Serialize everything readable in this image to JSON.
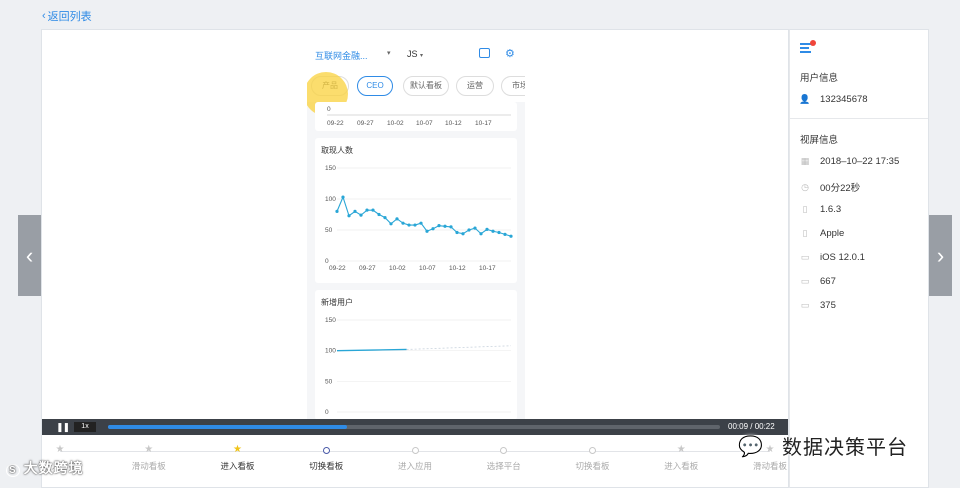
{
  "back_link": {
    "icon": "chevron-left-icon",
    "label": "返回列表"
  },
  "phone": {
    "app_name": "互联网金融...",
    "user": "JS",
    "tabs": [
      "产品",
      "CEO",
      "默认看板",
      "运营",
      "市场"
    ],
    "active_tab": "CEO",
    "top_axis_labels": [
      "09-22",
      "09-27",
      "10-02",
      "10-07",
      "10-12",
      "10-17"
    ],
    "top_axis_zero": "0",
    "cards": [
      {
        "title": "取现人数"
      },
      {
        "title": "新增用户"
      }
    ]
  },
  "chart_data": [
    {
      "type": "line",
      "title": "取现人数",
      "x": [
        "09-22",
        "09-23",
        "09-24",
        "09-25",
        "09-26",
        "09-27",
        "09-28",
        "09-29",
        "09-30",
        "10-01",
        "10-02",
        "10-03",
        "10-04",
        "10-05",
        "10-06",
        "10-07",
        "10-08",
        "10-09",
        "10-10",
        "10-11",
        "10-12",
        "10-13",
        "10-14",
        "10-15",
        "10-16",
        "10-17",
        "10-18",
        "10-19",
        "10-20",
        "10-21"
      ],
      "values": [
        80,
        103,
        73,
        80,
        74,
        82,
        82,
        75,
        70,
        60,
        68,
        61,
        58,
        58,
        61,
        48,
        52,
        57,
        56,
        55,
        46,
        44,
        50,
        53,
        44,
        51,
        48,
        46,
        43,
        40
      ],
      "tick_labels": [
        "09-22",
        "09-27",
        "10-02",
        "10-07",
        "10-12",
        "10-17"
      ],
      "y_ticks": [
        "0",
        "50",
        "100",
        "150"
      ],
      "ylim": [
        0,
        150
      ],
      "color": "#29a6d6"
    },
    {
      "type": "line",
      "title": "新增用户",
      "x": [
        "09-22",
        "09-27",
        "10-02",
        "10-07",
        "10-12",
        "10-17"
      ],
      "values": [
        100,
        101,
        102,
        104,
        106,
        108
      ],
      "y_ticks": [
        "0",
        "50",
        "100",
        "150"
      ],
      "ylim": [
        0,
        150
      ],
      "color": "#29a6d6"
    }
  ],
  "player": {
    "speed": "1x",
    "time": "00:09 / 00:22",
    "progress_fraction": 0.39
  },
  "timeline": [
    {
      "label": "进入看板",
      "marker": "star",
      "active": false
    },
    {
      "label": "滑动看板",
      "marker": "star",
      "active": false
    },
    {
      "label": "进入看板",
      "marker": "star",
      "active": true
    },
    {
      "label": "切换看板",
      "marker": "circle",
      "active": true
    },
    {
      "label": "进入应用",
      "marker": "circle",
      "active": false
    },
    {
      "label": "选择平台",
      "marker": "circle",
      "active": false
    },
    {
      "label": "切换看板",
      "marker": "circle",
      "active": false
    },
    {
      "label": "进入看板",
      "marker": "star",
      "active": false
    },
    {
      "label": "滑动看板",
      "marker": "star",
      "active": false
    }
  ],
  "sidebar": {
    "user_section": "用户信息",
    "user_id": "132345678",
    "screen_section": "视屏信息",
    "rows": [
      {
        "icon": "calendar-icon",
        "value": "2018–10–22 17:35"
      },
      {
        "icon": "clock-icon",
        "value": "00分22秒"
      },
      {
        "icon": "phone-icon",
        "value": "1.6.3"
      },
      {
        "icon": "phone-icon",
        "value": "Apple"
      },
      {
        "icon": "monitor-icon",
        "value": "iOS 12.0.1"
      },
      {
        "icon": "monitor-icon",
        "value": "667"
      },
      {
        "icon": "monitor-icon",
        "value": "375"
      }
    ]
  },
  "watermarks": {
    "left": "大数跨境",
    "right": "数据决策平台"
  },
  "colors": {
    "accent": "#2f8be6",
    "line": "#29a6d6",
    "star_active": "#f0c419",
    "player_bg": "#3c4148"
  }
}
